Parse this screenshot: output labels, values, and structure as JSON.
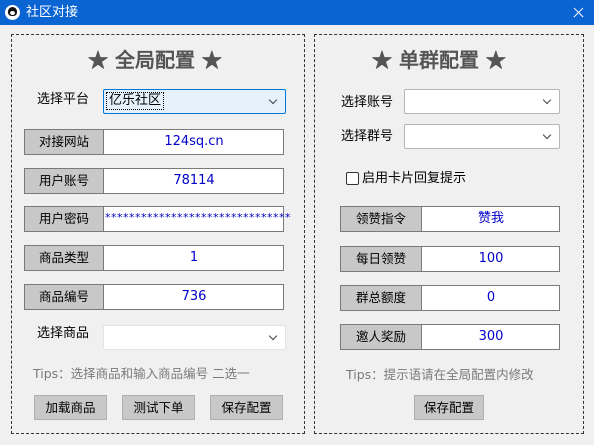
{
  "window": {
    "title": "社区对接"
  },
  "left": {
    "heading": "★ 全局配置 ★",
    "platform": {
      "label": "选择平台",
      "value": "亿乐社区"
    },
    "fields": [
      {
        "label": "对接网站",
        "value": "124sq.cn"
      },
      {
        "label": "用户账号",
        "value": "78114"
      },
      {
        "label": "用户密码",
        "value": "*******************************"
      },
      {
        "label": "商品类型",
        "value": "1"
      },
      {
        "label": "商品编号",
        "value": "736"
      }
    ],
    "product": {
      "label": "选择商品",
      "value": ""
    },
    "tips": "Tips：选择商品和输入商品编号 二选一",
    "buttons": {
      "load": "加载商品",
      "test": "测试下单",
      "save": "保存配置"
    }
  },
  "right": {
    "heading": "★ 单群配置 ★",
    "account": {
      "label": "选择账号",
      "value": ""
    },
    "group": {
      "label": "选择群号",
      "value": ""
    },
    "card_reply": {
      "label": "启用卡片回复提示",
      "checked": false
    },
    "fields": [
      {
        "label": "领赞指令",
        "value": "赞我"
      },
      {
        "label": "每日领赞",
        "value": "100"
      },
      {
        "label": "群总额度",
        "value": "0"
      },
      {
        "label": "邀人奖励",
        "value": "300"
      }
    ],
    "tips": "Tips：提示语请在全局配置内修改",
    "buttons": {
      "save": "保存配置"
    }
  }
}
